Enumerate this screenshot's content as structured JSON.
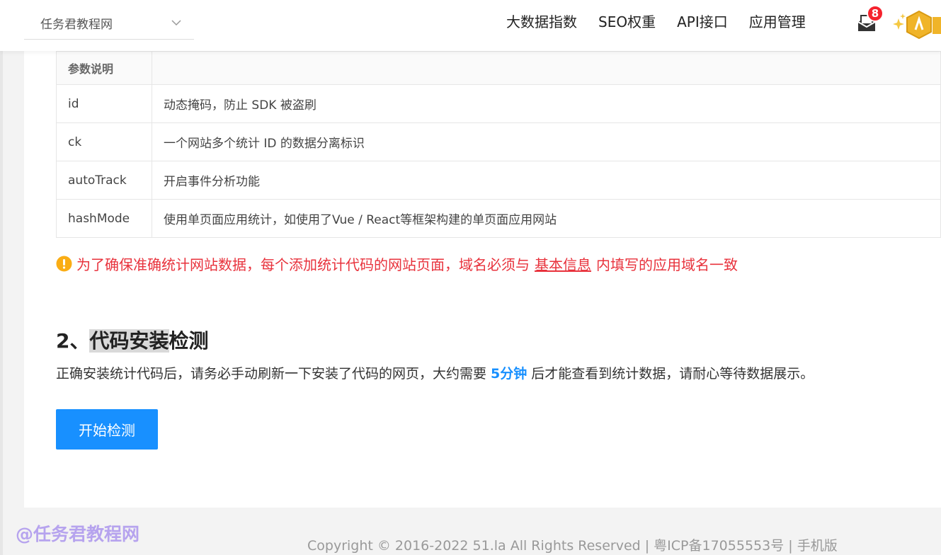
{
  "header": {
    "site_select": {
      "label": "任务君教程网",
      "icon": "chevron-down-icon"
    },
    "nav": [
      "大数据指数",
      "SEO权重",
      "API接口",
      "应用管理"
    ],
    "message_badge": "8",
    "colors": {
      "badge": "#f5222d",
      "accent": "#1890ff"
    }
  },
  "params_table": {
    "header": "参数说明",
    "rows": [
      {
        "key": "id",
        "desc": "动态掩码，防止 SDK 被盗刷"
      },
      {
        "key": "ck",
        "desc": "一个网站多个统计 ID 的数据分离标识"
      },
      {
        "key": "autoTrack",
        "desc": "开启事件分析功能"
      },
      {
        "key": "hashMode",
        "desc": "使用单页面应用统计，如使用了Vue / React等框架构建的单页面应用网站"
      }
    ]
  },
  "warning": {
    "pre": "为了确保准确统计网站数据，每个添加统计代码的网站页面，域名必须与",
    "link": "基本信息",
    "post": "内填写的应用域名一致"
  },
  "section": {
    "title_prefix": "2、",
    "title_highlight": "代码安装",
    "title_suffix": "检测",
    "desc_pre": "正确安装统计代码后，请务必手动刷新一下安装了代码的网页，大约需要",
    "desc_em": "5分钟",
    "desc_post": "后才能查看到统计数据，请耐心等待数据展示。",
    "button": "开始检测"
  },
  "footer": {
    "watermark": "@任务君教程网",
    "copyright": "Copyright © 2016-2022 51.la All Rights Reserved | 粤ICP备17055553号 | 手机版"
  }
}
